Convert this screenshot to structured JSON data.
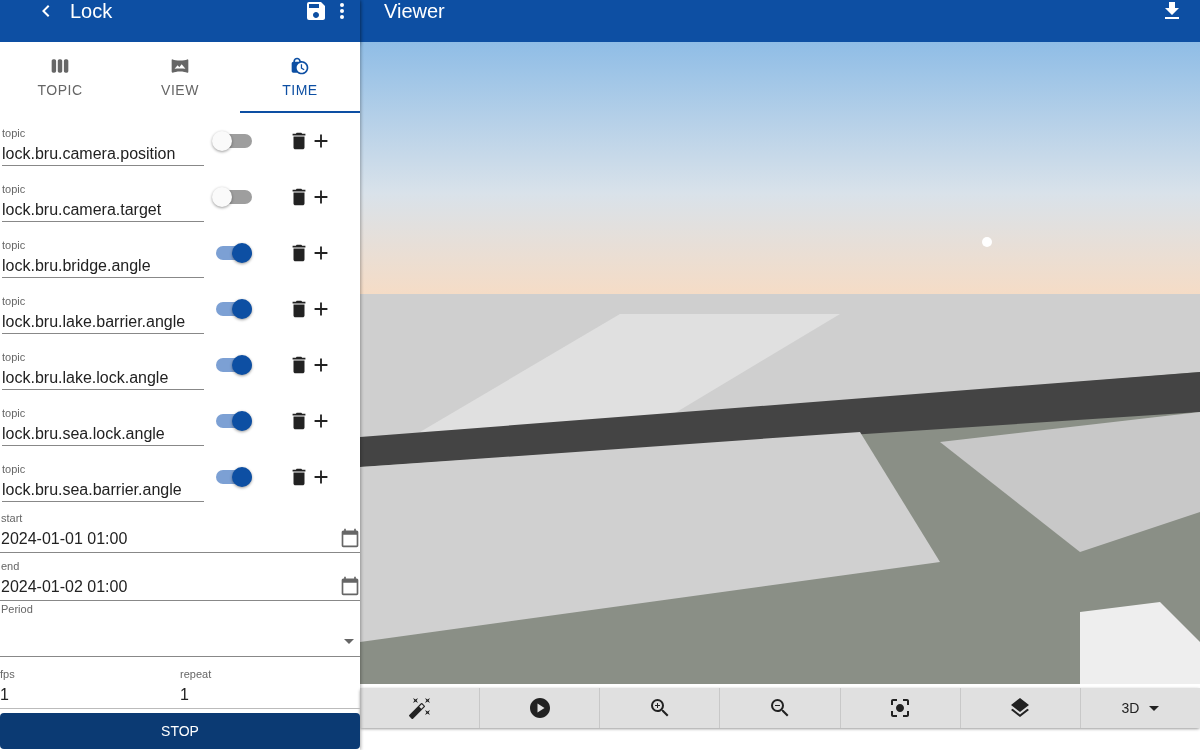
{
  "left_header": {
    "title": "Lock"
  },
  "right_header": {
    "title": "Viewer"
  },
  "tabs": [
    {
      "label": "TOPIC",
      "selected": false,
      "kind": "columns"
    },
    {
      "label": "VIEW",
      "selected": false,
      "kind": "view"
    },
    {
      "label": "TIME",
      "selected": true,
      "kind": "time"
    }
  ],
  "topics": [
    {
      "label": "topic",
      "value": "lock.bru.camera.position",
      "on": false
    },
    {
      "label": "topic",
      "value": "lock.bru.camera.target",
      "on": false
    },
    {
      "label": "topic",
      "value": "lock.bru.bridge.angle",
      "on": true
    },
    {
      "label": "topic",
      "value": "lock.bru.lake.barrier.angle",
      "on": true
    },
    {
      "label": "topic",
      "value": "lock.bru.lake.lock.angle",
      "on": true
    },
    {
      "label": "topic",
      "value": "lock.bru.sea.lock.angle",
      "on": true
    },
    {
      "label": "topic",
      "value": "lock.bru.sea.barrier.angle",
      "on": true
    }
  ],
  "start": {
    "label": "start",
    "value": "2024-01-01 01:00"
  },
  "end": {
    "label": "end",
    "value": "2024-01-02 01:00"
  },
  "period": {
    "label": "Period"
  },
  "fps": {
    "label": "fps",
    "value": "1"
  },
  "repeat": {
    "label": "repeat",
    "value": "1"
  },
  "stop_button": "STOP",
  "toolbar": [
    {
      "kind": "wand"
    },
    {
      "kind": "play"
    },
    {
      "kind": "zoom-in"
    },
    {
      "kind": "zoom-out"
    },
    {
      "kind": "focus"
    },
    {
      "kind": "layers"
    },
    {
      "kind": "mode",
      "label": "3D"
    }
  ]
}
